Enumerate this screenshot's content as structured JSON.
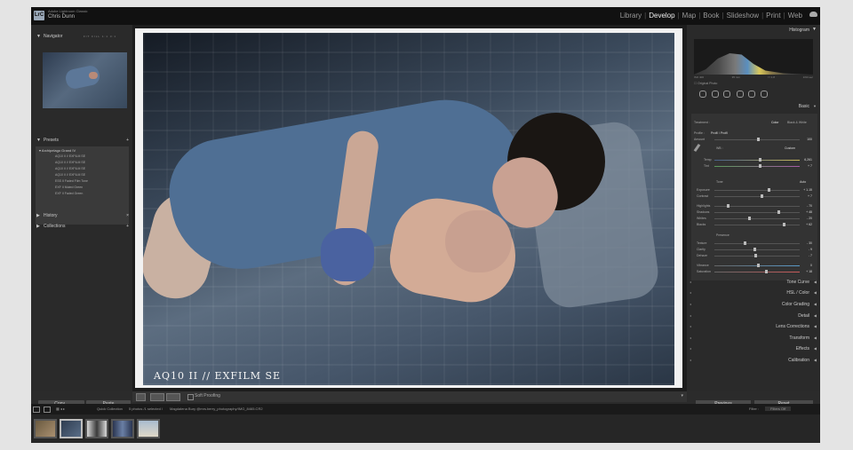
{
  "topbar": {
    "app_name": "Adobe Lightroom Classic",
    "user_name": "Chris Dunn",
    "logo": "LrC",
    "modules": [
      "Library",
      "Develop",
      "Map",
      "Book",
      "Slideshow",
      "Print",
      "Web"
    ],
    "active_module": "Develop"
  },
  "left": {
    "navigator": {
      "title": "Navigator",
      "zoom": "FIT   FILL   1:1   3:1"
    },
    "presets": {
      "title": "Presets",
      "folder": "Archipelago Grand IV",
      "items": [
        "AQ10 II // EXFILM SE",
        "AQ10 II // EXFILM SE",
        "AQ10 II // EXFILM SE",
        "AQ10 II // EXFILM SE",
        "ESS II Faded Film Tone",
        "EXF II Muted Green",
        "EXF II Faded Green"
      ]
    },
    "history": "History",
    "collections": "Collections",
    "copy": "Copy...",
    "paste": "Paste"
  },
  "photo": {
    "watermark": "AQ10 II // EXFILM SE"
  },
  "toolbar": {
    "soft_proofing": "Soft Proofing"
  },
  "right": {
    "histogram_title": "Histogram",
    "hist_values": [
      "ISO 400",
      "35 mm",
      "f / 1.8",
      "1/60 sec"
    ],
    "original_photo": "Original Photo",
    "basic_title": "Basic",
    "treatment_label": "Treatment :",
    "treatment_color": "Color",
    "treatment_bw": "Black & White",
    "profile_label": "Profile :",
    "profile_value": "Profil / Profil",
    "amount_label": "Amount",
    "amount_value": "100",
    "wb_label": "WB :",
    "wb_value": "Custom",
    "temp_label": "Temp",
    "temp_value": "6,261",
    "tint_label": "Tint",
    "tint_value": "+ 7",
    "tone_label": "Tone",
    "auto_label": "Auto",
    "sliders": [
      {
        "label": "Exposure",
        "value": "+ 1.15"
      },
      {
        "label": "Contrast",
        "value": "+ 7"
      },
      {
        "label": "Highlights",
        "value": "- 70"
      },
      {
        "label": "Shadows",
        "value": "+ 48"
      },
      {
        "label": "Whites",
        "value": "- 20"
      },
      {
        "label": "Blacks",
        "value": "+ 62"
      }
    ],
    "presence_label": "Presence",
    "presence_sliders": [
      {
        "label": "Texture",
        "value": "- 30"
      },
      {
        "label": "Clarity",
        "value": "- 9"
      },
      {
        "label": "Dehaze",
        "value": "- 7"
      },
      {
        "label": "Vibrance",
        "value": "0"
      },
      {
        "label": "Saturation",
        "value": "+ 18"
      }
    ],
    "sections": [
      "Tone Curve",
      "HSL / Color",
      "Color Grading",
      "Detail",
      "Lens Corrections",
      "Transform",
      "Effects",
      "Calibration"
    ],
    "previous": "Previous",
    "reset": "Reset"
  },
  "filmbar": {
    "source": "Quick Collection",
    "count": "5 photos /1 selected /",
    "path": "Magdalena Bury @mrs.berry_photography/IMG_8465.CR2",
    "filter_label": "Filter :",
    "filter_value": "Filters Off"
  },
  "icons": {
    "cloud": "cloud-icon",
    "eyedropper": "eyedropper-icon"
  }
}
